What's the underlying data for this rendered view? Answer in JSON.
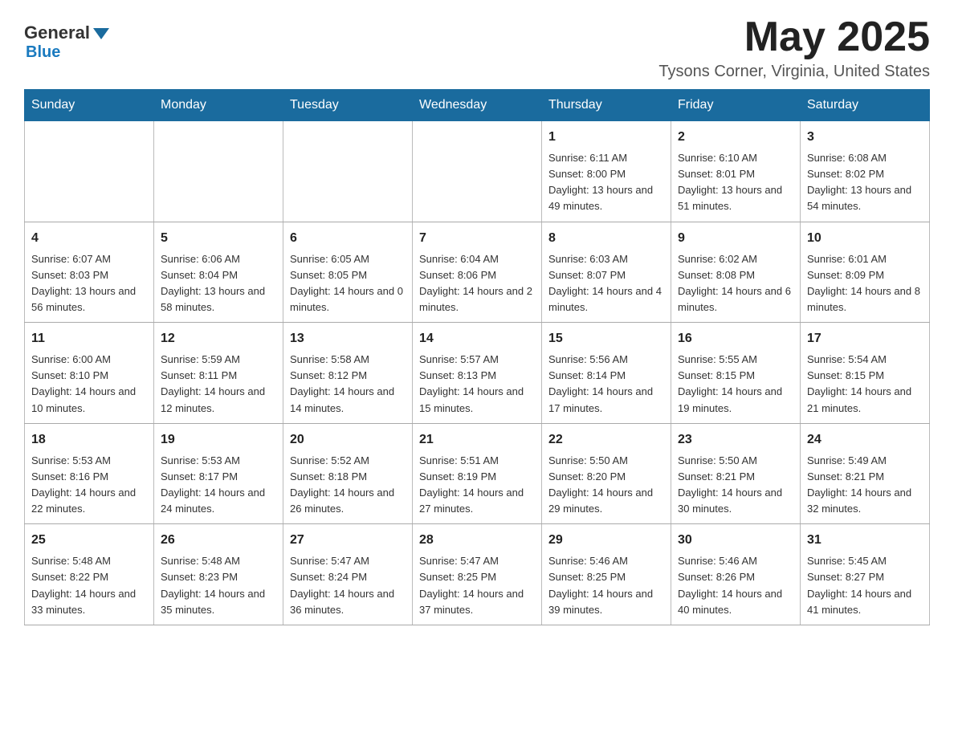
{
  "header": {
    "logo_general": "General",
    "logo_blue": "Blue",
    "month": "May 2025",
    "location": "Tysons Corner, Virginia, United States"
  },
  "days_of_week": [
    "Sunday",
    "Monday",
    "Tuesday",
    "Wednesday",
    "Thursday",
    "Friday",
    "Saturday"
  ],
  "weeks": [
    [
      {
        "day": "",
        "info": ""
      },
      {
        "day": "",
        "info": ""
      },
      {
        "day": "",
        "info": ""
      },
      {
        "day": "",
        "info": ""
      },
      {
        "day": "1",
        "info": "Sunrise: 6:11 AM\nSunset: 8:00 PM\nDaylight: 13 hours and 49 minutes."
      },
      {
        "day": "2",
        "info": "Sunrise: 6:10 AM\nSunset: 8:01 PM\nDaylight: 13 hours and 51 minutes."
      },
      {
        "day": "3",
        "info": "Sunrise: 6:08 AM\nSunset: 8:02 PM\nDaylight: 13 hours and 54 minutes."
      }
    ],
    [
      {
        "day": "4",
        "info": "Sunrise: 6:07 AM\nSunset: 8:03 PM\nDaylight: 13 hours and 56 minutes."
      },
      {
        "day": "5",
        "info": "Sunrise: 6:06 AM\nSunset: 8:04 PM\nDaylight: 13 hours and 58 minutes."
      },
      {
        "day": "6",
        "info": "Sunrise: 6:05 AM\nSunset: 8:05 PM\nDaylight: 14 hours and 0 minutes."
      },
      {
        "day": "7",
        "info": "Sunrise: 6:04 AM\nSunset: 8:06 PM\nDaylight: 14 hours and 2 minutes."
      },
      {
        "day": "8",
        "info": "Sunrise: 6:03 AM\nSunset: 8:07 PM\nDaylight: 14 hours and 4 minutes."
      },
      {
        "day": "9",
        "info": "Sunrise: 6:02 AM\nSunset: 8:08 PM\nDaylight: 14 hours and 6 minutes."
      },
      {
        "day": "10",
        "info": "Sunrise: 6:01 AM\nSunset: 8:09 PM\nDaylight: 14 hours and 8 minutes."
      }
    ],
    [
      {
        "day": "11",
        "info": "Sunrise: 6:00 AM\nSunset: 8:10 PM\nDaylight: 14 hours and 10 minutes."
      },
      {
        "day": "12",
        "info": "Sunrise: 5:59 AM\nSunset: 8:11 PM\nDaylight: 14 hours and 12 minutes."
      },
      {
        "day": "13",
        "info": "Sunrise: 5:58 AM\nSunset: 8:12 PM\nDaylight: 14 hours and 14 minutes."
      },
      {
        "day": "14",
        "info": "Sunrise: 5:57 AM\nSunset: 8:13 PM\nDaylight: 14 hours and 15 minutes."
      },
      {
        "day": "15",
        "info": "Sunrise: 5:56 AM\nSunset: 8:14 PM\nDaylight: 14 hours and 17 minutes."
      },
      {
        "day": "16",
        "info": "Sunrise: 5:55 AM\nSunset: 8:15 PM\nDaylight: 14 hours and 19 minutes."
      },
      {
        "day": "17",
        "info": "Sunrise: 5:54 AM\nSunset: 8:15 PM\nDaylight: 14 hours and 21 minutes."
      }
    ],
    [
      {
        "day": "18",
        "info": "Sunrise: 5:53 AM\nSunset: 8:16 PM\nDaylight: 14 hours and 22 minutes."
      },
      {
        "day": "19",
        "info": "Sunrise: 5:53 AM\nSunset: 8:17 PM\nDaylight: 14 hours and 24 minutes."
      },
      {
        "day": "20",
        "info": "Sunrise: 5:52 AM\nSunset: 8:18 PM\nDaylight: 14 hours and 26 minutes."
      },
      {
        "day": "21",
        "info": "Sunrise: 5:51 AM\nSunset: 8:19 PM\nDaylight: 14 hours and 27 minutes."
      },
      {
        "day": "22",
        "info": "Sunrise: 5:50 AM\nSunset: 8:20 PM\nDaylight: 14 hours and 29 minutes."
      },
      {
        "day": "23",
        "info": "Sunrise: 5:50 AM\nSunset: 8:21 PM\nDaylight: 14 hours and 30 minutes."
      },
      {
        "day": "24",
        "info": "Sunrise: 5:49 AM\nSunset: 8:21 PM\nDaylight: 14 hours and 32 minutes."
      }
    ],
    [
      {
        "day": "25",
        "info": "Sunrise: 5:48 AM\nSunset: 8:22 PM\nDaylight: 14 hours and 33 minutes."
      },
      {
        "day": "26",
        "info": "Sunrise: 5:48 AM\nSunset: 8:23 PM\nDaylight: 14 hours and 35 minutes."
      },
      {
        "day": "27",
        "info": "Sunrise: 5:47 AM\nSunset: 8:24 PM\nDaylight: 14 hours and 36 minutes."
      },
      {
        "day": "28",
        "info": "Sunrise: 5:47 AM\nSunset: 8:25 PM\nDaylight: 14 hours and 37 minutes."
      },
      {
        "day": "29",
        "info": "Sunrise: 5:46 AM\nSunset: 8:25 PM\nDaylight: 14 hours and 39 minutes."
      },
      {
        "day": "30",
        "info": "Sunrise: 5:46 AM\nSunset: 8:26 PM\nDaylight: 14 hours and 40 minutes."
      },
      {
        "day": "31",
        "info": "Sunrise: 5:45 AM\nSunset: 8:27 PM\nDaylight: 14 hours and 41 minutes."
      }
    ]
  ]
}
